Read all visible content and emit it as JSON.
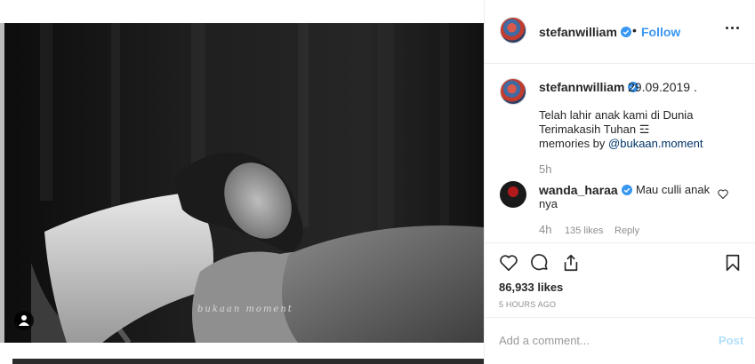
{
  "post": {
    "username": "stefanwilliam",
    "follow_label": "Follow",
    "dot": "•",
    "watermark": "bukaan moment"
  },
  "caption": {
    "username": "stefannwilliam",
    "date": "29.09.2019 .",
    "line1": "Telah lahir anak kami di Dunia",
    "line2": "Terimakasih Tuhan ☲",
    "line3_prefix": "memories by ",
    "mention": "@bukaan.moment",
    "time": "5h"
  },
  "reply": {
    "username": "wanda_haraa",
    "text_line1": "Mau culli anak",
    "text_line2": "nya",
    "time": "4h",
    "likes": "135 likes",
    "reply_label": "Reply"
  },
  "stats": {
    "likes": "86,933 likes",
    "ago": "5 HOURS AGO"
  },
  "comment_box": {
    "placeholder": "Add a comment...",
    "post_label": "Post"
  },
  "icons": {
    "heart": "heart-icon",
    "comment": "comment-icon",
    "share": "share-icon",
    "save": "bookmark-icon",
    "verified": "verified-icon",
    "more": "more-options-icon",
    "user_tag": "user-tag-icon"
  },
  "colors": {
    "link_blue": "#3897f0",
    "mention": "#003569",
    "muted": "#8e8e8e",
    "post_disabled": "#b2dffc"
  }
}
